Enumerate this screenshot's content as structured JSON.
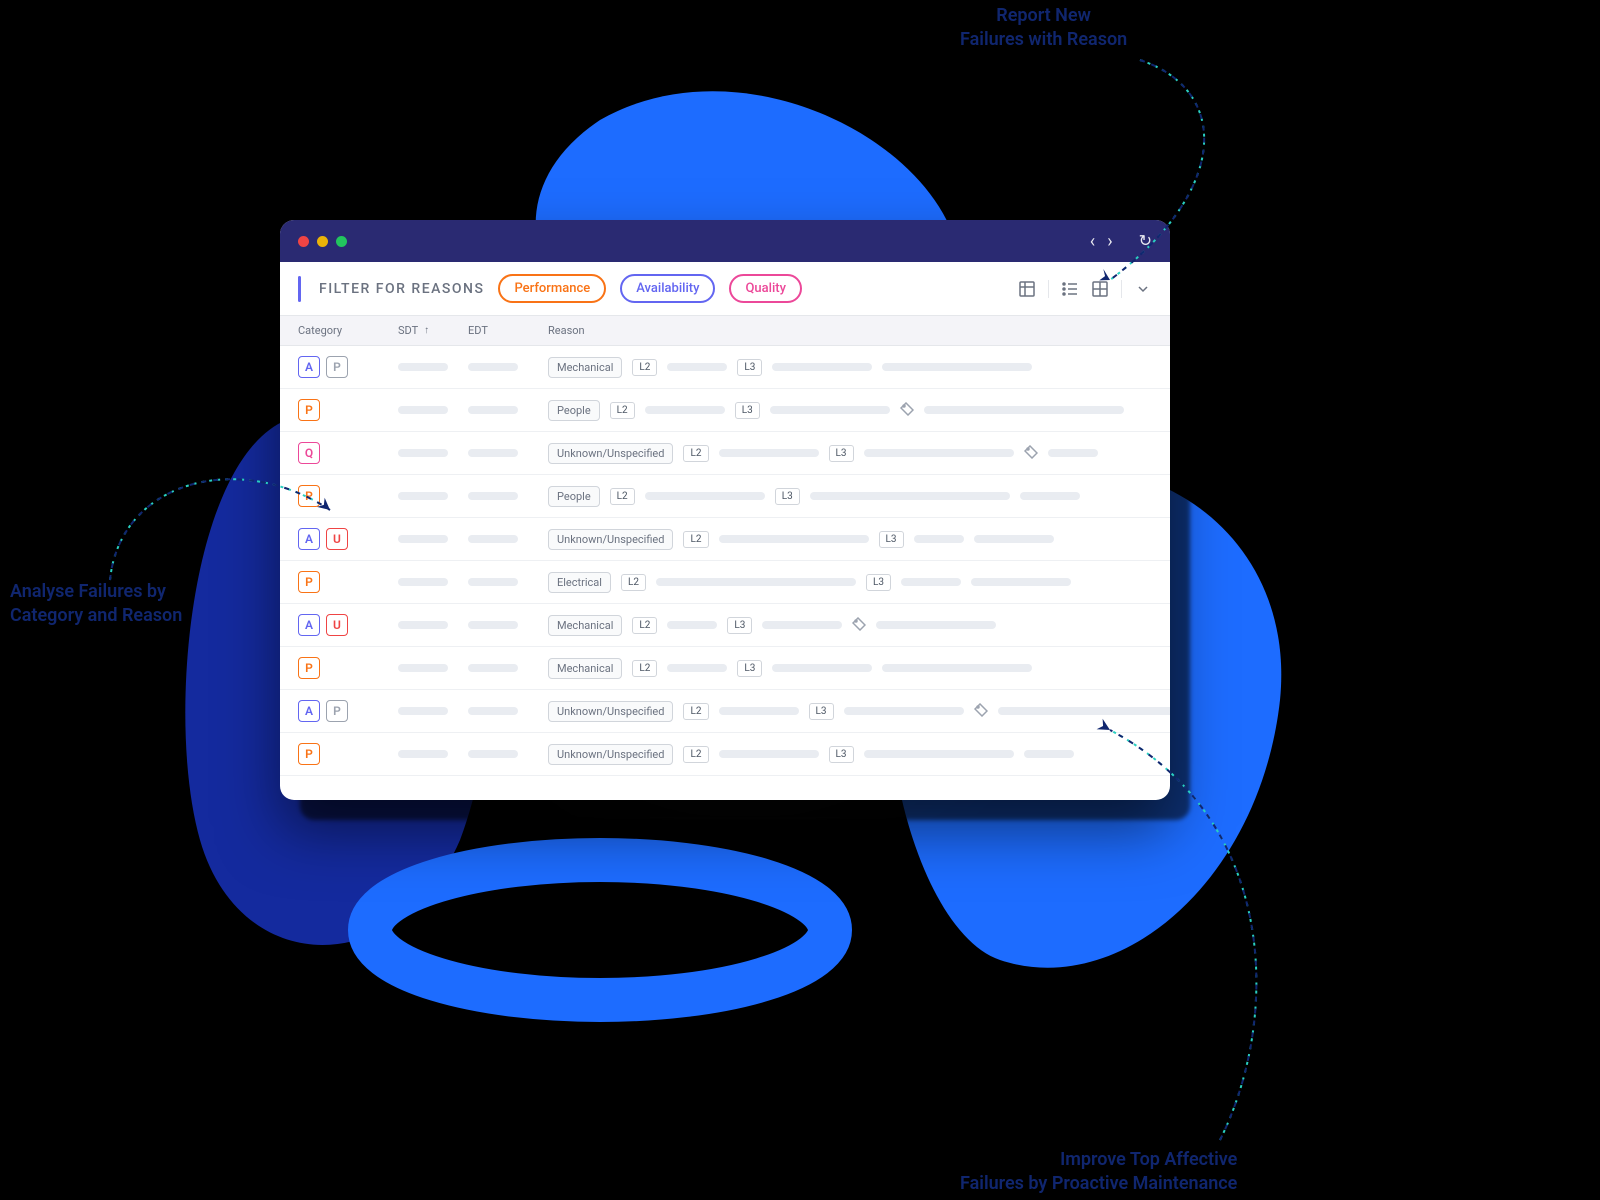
{
  "annotations": {
    "top_right": {
      "line1": "Report New",
      "line2": "Failures with Reason"
    },
    "left": {
      "line1": "Analyse Failures by",
      "line2": "Category and Reason"
    },
    "bottom_right": {
      "line1": "Improve Top Affective",
      "line2": "Failures by Proactive Maintenance"
    }
  },
  "titlebar": {
    "back_icon": "‹",
    "fwd_icon": "›",
    "reload_icon": "↻"
  },
  "filterbar": {
    "title": "FILTER FOR REASONS",
    "pills": {
      "perf": "Performance",
      "avail": "Availability",
      "qual": "Quality"
    }
  },
  "columns": {
    "category": "Category",
    "sdt": "SDT",
    "sort_arrow": "↑",
    "edt": "EDT",
    "reason": "Reason"
  },
  "levels": {
    "l2": "L2",
    "l3": "L3"
  },
  "rows": [
    {
      "cats": [
        "A",
        "Pg"
      ],
      "reason": "Mechanical",
      "tag": false
    },
    {
      "cats": [
        "P"
      ],
      "reason": "People",
      "tag": true
    },
    {
      "cats": [
        "Q"
      ],
      "reason": "Unknown/Unspecified",
      "tag": true
    },
    {
      "cats": [
        "P"
      ],
      "reason": "People",
      "tag": false
    },
    {
      "cats": [
        "A",
        "U"
      ],
      "reason": "Unknown/Unspecified",
      "tag": false
    },
    {
      "cats": [
        "P"
      ],
      "reason": "Electrical",
      "tag": false
    },
    {
      "cats": [
        "A",
        "U"
      ],
      "reason": "Mechanical",
      "tag": true
    },
    {
      "cats": [
        "P"
      ],
      "reason": "Mechanical",
      "tag": false
    },
    {
      "cats": [
        "A",
        "Pg"
      ],
      "reason": "Unknown/Unspecified",
      "tag": true
    },
    {
      "cats": [
        "P"
      ],
      "reason": "Unknown/Unspecified",
      "tag": false
    }
  ],
  "colors": {
    "brand_blue": "#2a2a72",
    "accent_blue": "#1d6cff",
    "orange": "#f97316",
    "violet": "#6366f1",
    "pink": "#ec4899",
    "red": "#ef4444",
    "gray": "#9ca3af",
    "annotation": "#10266f",
    "teal_dash": "#29cfc1"
  }
}
